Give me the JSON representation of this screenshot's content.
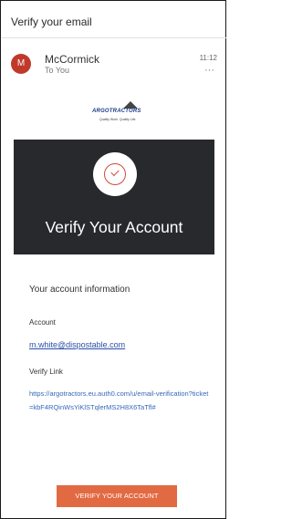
{
  "email": {
    "subject": "Verify your email",
    "sender": {
      "initial": "M",
      "name": "McCormick",
      "recipient": "To You",
      "time": "11:12",
      "avatar_color": "#c0392b"
    }
  },
  "logo": {
    "name": "ARGOTRACTORS",
    "tagline": "Quality Work. Quality Life."
  },
  "hero": {
    "title": "Verify Your Account",
    "background_color": "#28292d",
    "icon": "check-circle-icon"
  },
  "account_info": {
    "heading": "Your account information",
    "account_label": "Account",
    "account_email": "m.white@dispostable.com",
    "verify_label": "Verify Link",
    "verify_link": "https://argotractors.eu.auth0.com/u/email-verification?ticket=kbF4RQinWsYiKlSTqlerMS2H8X6TaTfl#"
  },
  "actions": {
    "verify_button_label": "VERIFY YOUR ACCOUNT",
    "button_color": "#e26a43"
  }
}
